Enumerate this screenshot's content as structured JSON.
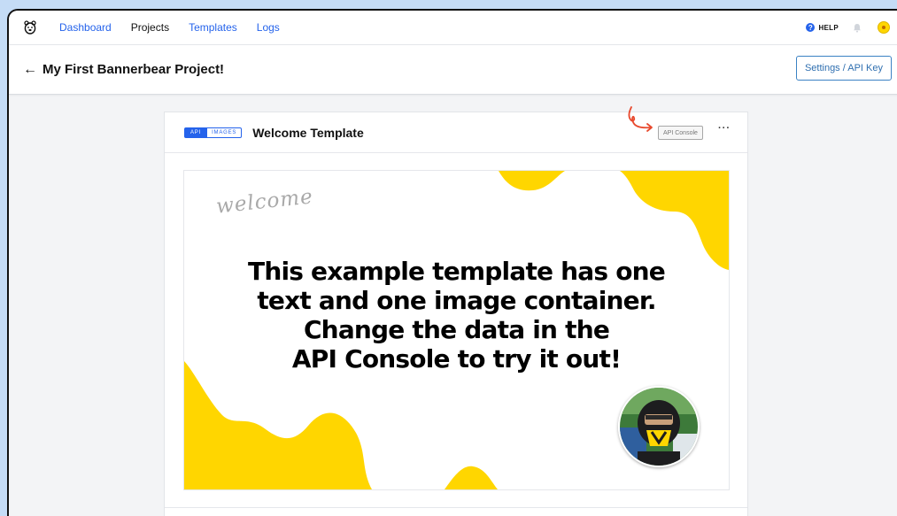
{
  "nav": {
    "links": [
      "Dashboard",
      "Projects",
      "Templates",
      "Logs"
    ],
    "active_index": 1,
    "help_label": "HELP"
  },
  "header": {
    "title": "My First Bannerbear Project!",
    "settings_label": "Settings / API Key"
  },
  "card": {
    "badge_api": "API",
    "badge_images": "IMAGES",
    "template_name": "Welcome Template",
    "api_console_label": "API Console",
    "more_label": "···"
  },
  "preview": {
    "script_text": "welcome",
    "headline_lines": [
      "This example template has one",
      "text and one image container.",
      "Change the data in the",
      "API Console to try it out!"
    ]
  },
  "colors": {
    "link": "#2563eb",
    "accent_yellow": "#ffd600",
    "background": "#c5dcf6"
  },
  "icons": [
    "bear-logo-icon",
    "back-arrow-icon",
    "help-icon",
    "bell-icon",
    "avatar-icon",
    "red-arrow-annotation-icon"
  ]
}
